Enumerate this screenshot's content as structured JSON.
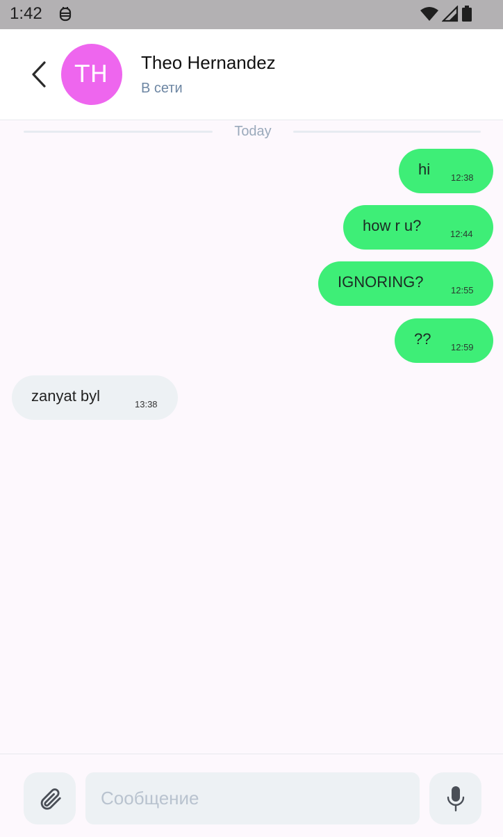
{
  "status_bar": {
    "time": "1:42",
    "icons": [
      "app-notification-icon",
      "wifi-icon",
      "cell-signal-icon",
      "battery-icon"
    ]
  },
  "header": {
    "back_icon": "chevron-left-icon",
    "avatar_initials": "TH",
    "avatar_color": "#ee66ee",
    "contact_name": "Theo Hernandez",
    "contact_status": "В сети"
  },
  "chat": {
    "date_separator": "Today",
    "messages": [
      {
        "direction": "outgoing",
        "text": "hi",
        "time": "12:38"
      },
      {
        "direction": "outgoing",
        "text": "how r u?",
        "time": "12:44"
      },
      {
        "direction": "outgoing",
        "text": "IGNORING?",
        "time": "12:55"
      },
      {
        "direction": "outgoing",
        "text": "??",
        "time": "12:59"
      },
      {
        "direction": "incoming",
        "text": "zanyat byl",
        "time": "13:38"
      }
    ]
  },
  "composer": {
    "attach_icon": "paperclip-icon",
    "input_value": "",
    "input_placeholder": "Сообщение",
    "mic_icon": "microphone-icon"
  },
  "colors": {
    "outgoing_bubble": "#3eee77",
    "incoming_bubble": "#edf1f4",
    "background": "#fdf8fd",
    "status_text": "#6d86a3"
  }
}
